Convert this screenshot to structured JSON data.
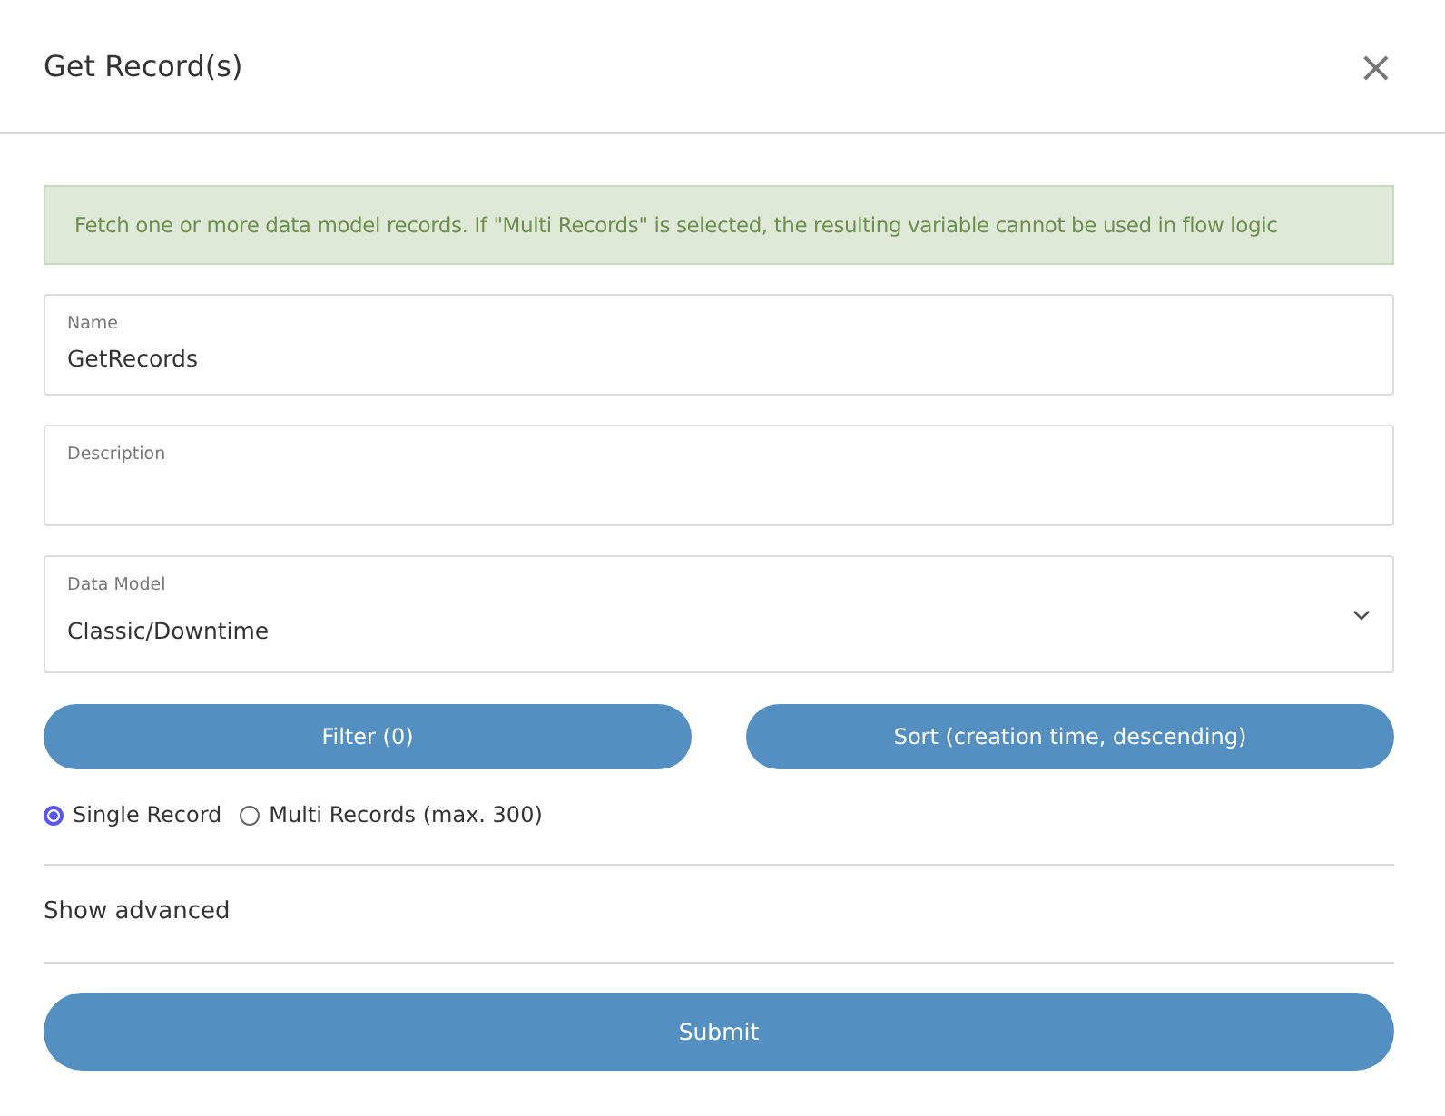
{
  "dialog": {
    "title": "Get Record(s)",
    "close": "×"
  },
  "alert": "Fetch one or more data model records. If \"Multi Records\" is selected, the resulting variable cannot be used in flow logic",
  "fields": [
    {
      "kind": "text",
      "label": "Name",
      "value": "GetRecords"
    },
    {
      "kind": "textarea",
      "label": "Description"
    },
    {
      "kind": "select",
      "label": "Data Model",
      "value": "Classic/Downtime"
    }
  ],
  "buttons": [
    "Filter (0)",
    "Sort (creation time, descending)"
  ],
  "record_mode": [
    {
      "label": "Single Record",
      "selected": true
    },
    {
      "label": "Multi Records (max. 300)",
      "selected": false
    }
  ],
  "advanced_toggle": "Show advanced",
  "submit": "Submit"
}
